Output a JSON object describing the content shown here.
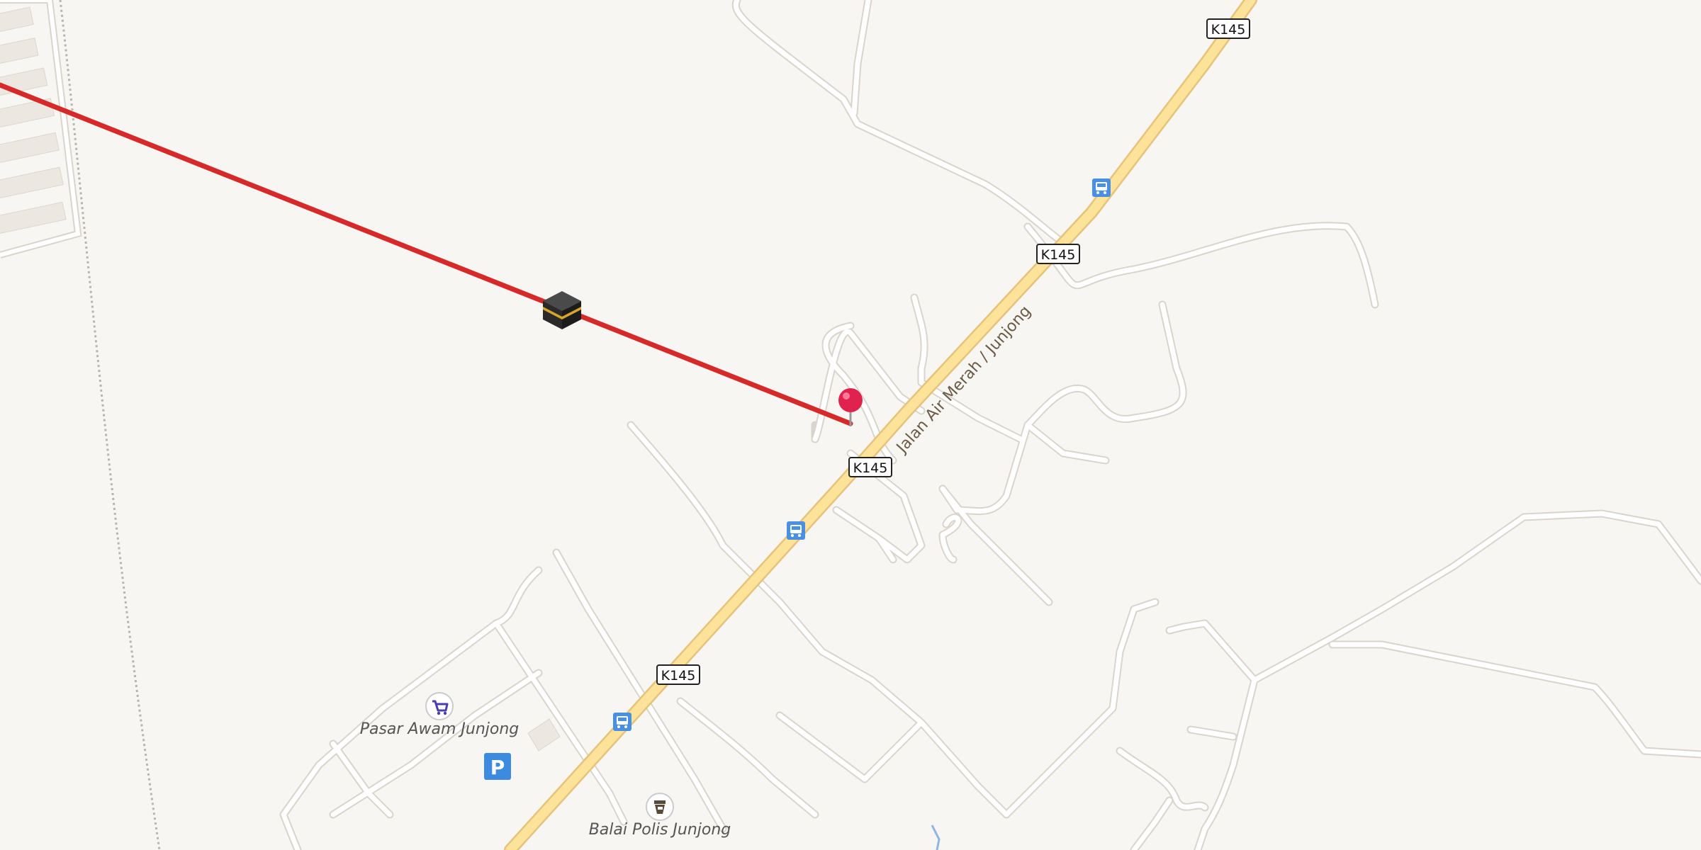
{
  "map": {
    "route_shield": "K145",
    "road_name": "Jalan Air Merah / Junjong",
    "places": {
      "market": "Pasar Awam Junjong",
      "police": "Balai Polis Junjong"
    },
    "icons": {
      "bus_stop": "bus-stop-icon",
      "parking": "parking-icon",
      "kaaba": "kaaba-icon",
      "pin": "map-pin-icon",
      "shopping": "shopping-cart-icon",
      "police": "police-icon"
    },
    "colors": {
      "background": "#f8f6f2",
      "main_road_fill": "#fde29a",
      "main_road_casing": "#e6c37a",
      "minor_road": "#ffffff",
      "minor_road_casing": "#d9d4cc",
      "qibla_line": "#d62a2a",
      "pin": "#e0224f",
      "bus_icon": "#4a90e2",
      "parking_icon": "#3d8be0"
    }
  }
}
